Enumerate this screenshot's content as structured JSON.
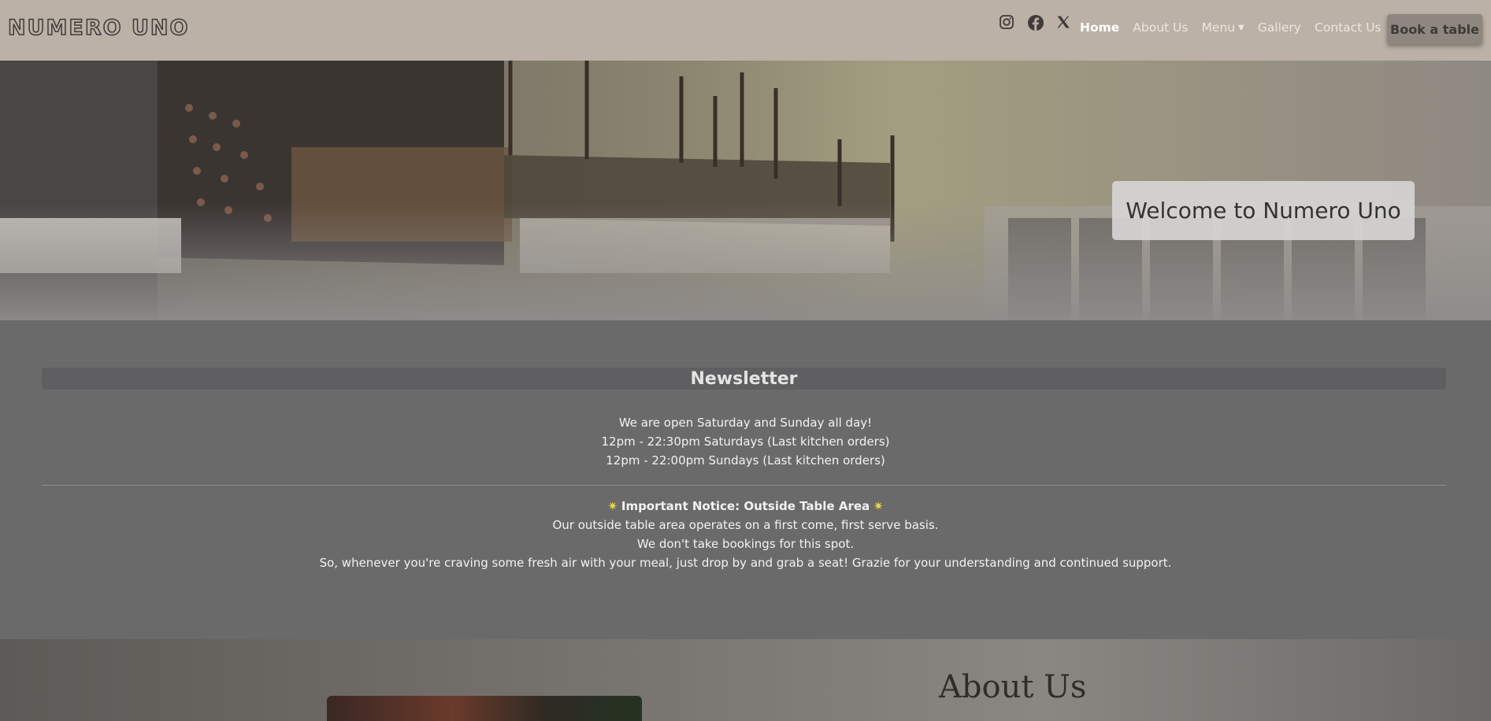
{
  "navbar": {
    "brand": "NUMERO UNO",
    "social_icons": [
      "instagram-icon",
      "facebook-icon",
      "x-icon"
    ],
    "links": [
      {
        "label": "Home",
        "active": true
      },
      {
        "label": "About Us",
        "active": false
      },
      {
        "label": "Menu",
        "active": false,
        "dropdown": true
      },
      {
        "label": "Gallery",
        "active": false
      },
      {
        "label": "Contact Us",
        "active": false
      }
    ],
    "book_button": "Book a table"
  },
  "hero": {
    "welcome": "Welcome to Numero Uno"
  },
  "newsletter": {
    "title": "Newsletter",
    "hours": [
      "We are open Saturday and Sunday all day!",
      "12pm - 22:30pm Saturdays (Last kitchen orders)",
      "12pm - 22:00pm Sundays (Last kitchen orders)"
    ],
    "notice_title": "Important Notice: Outside Table Area",
    "notice_lines": [
      "Our outside table area operates on a first come, first serve basis.",
      "We don't take bookings for this spot.",
      "So, whenever you're craving some fresh air with your meal, just drop by and grab a seat! Grazie for your understanding and continued support."
    ]
  },
  "about": {
    "title": "About Us"
  },
  "colors": {
    "navbar_bg": "#bcb1a6",
    "newsletter_bg": "#6b6a6b",
    "star": "#e8d44a"
  }
}
